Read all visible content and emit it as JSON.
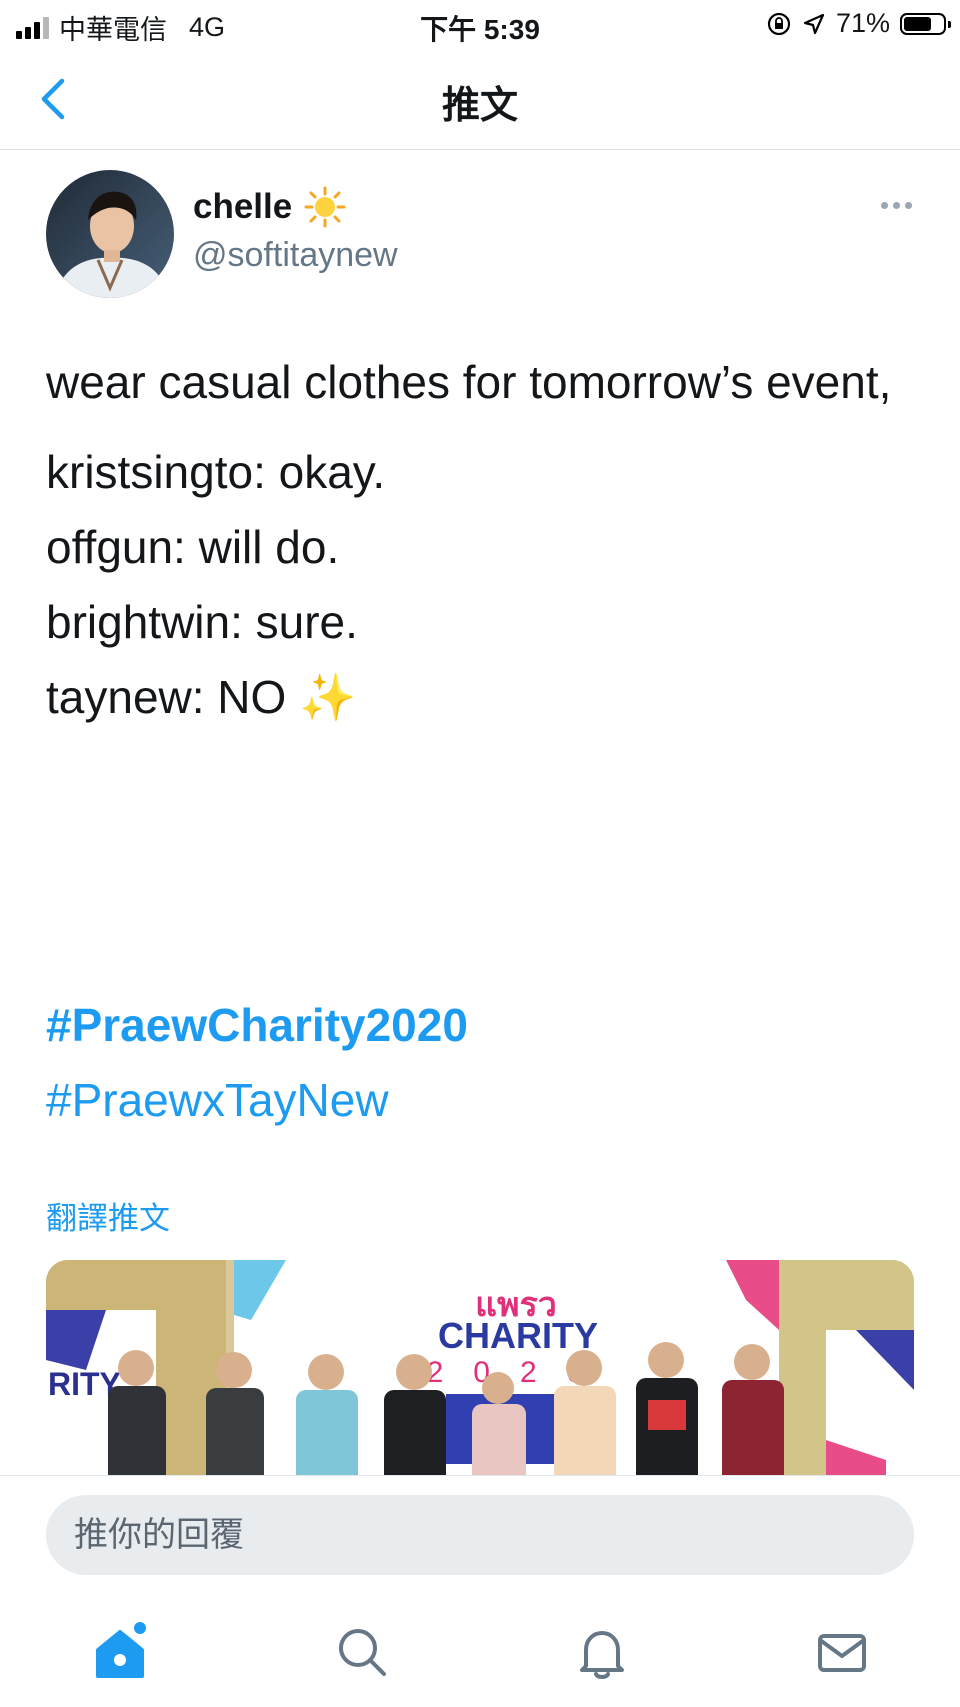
{
  "status_bar": {
    "carrier": "中華電信",
    "network": "4G",
    "time": "下午 5:39",
    "battery": "71%",
    "battery_level": 0.71
  },
  "nav": {
    "title": "推文",
    "back_icon": "chevron-left-icon"
  },
  "tweet": {
    "display_name": "chelle",
    "name_emoji": "☀️",
    "handle": "@softitaynew",
    "text_lines": [
      "wear casual clothes for tomorrow’s event,",
      "kristsingto: okay.",
      "offgun: will do.",
      "brightwin: sure.",
      "taynew: NO ✨"
    ],
    "hashtags": [
      "#PraewCharity2020",
      "#PraewxTayNew"
    ],
    "translate_label": "翻譯推文",
    "media": {
      "banner_logo": "แพรว",
      "banner_title": "CHARITY",
      "banner_year": "2020",
      "left_panel_text": "RITY"
    }
  },
  "reply": {
    "placeholder": "推你的回覆"
  },
  "tab_bar": {
    "tabs": [
      "home-icon",
      "search-icon",
      "bell-icon",
      "mail-icon"
    ],
    "active": "home-icon",
    "accent": "#1d9bf0"
  },
  "colors": {
    "accent": "#1d9bf0",
    "text": "#14171a",
    "secondary": "#657786"
  }
}
